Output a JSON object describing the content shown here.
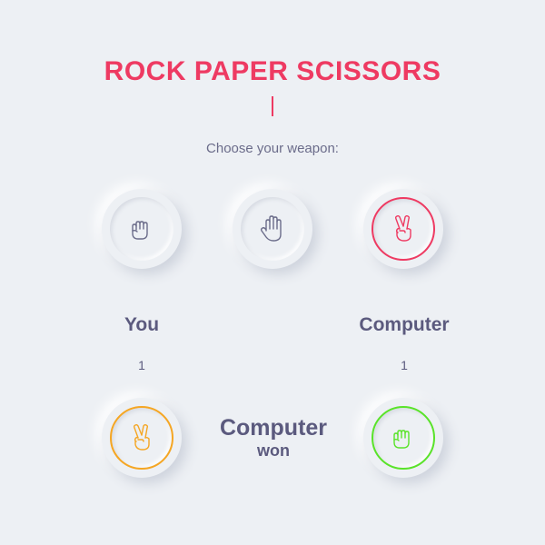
{
  "title": "ROCK PAPER SCISSORS",
  "prompt": "Choose your weapon:",
  "weapons": [
    {
      "name": "rock",
      "icon": "fist-icon",
      "color": "#6b6c8a"
    },
    {
      "name": "paper",
      "icon": "open-hand-icon",
      "color": "#6b6c8a"
    },
    {
      "name": "scissors",
      "icon": "victory-hand-icon",
      "color": "#ee3a62"
    }
  ],
  "players": {
    "you": {
      "label": "You",
      "score": "1"
    },
    "computer": {
      "label": "Computer",
      "score": "1"
    }
  },
  "result": {
    "winner": "Computer",
    "verb": "won"
  },
  "choices": {
    "you": {
      "icon": "victory-hand-icon",
      "color": "#f5a623"
    },
    "computer": {
      "icon": "fist-icon",
      "color": "#59e329"
    }
  },
  "colors": {
    "accent": "#ee3a62",
    "text": "#5b5a7e",
    "background": "#edf0f4"
  }
}
